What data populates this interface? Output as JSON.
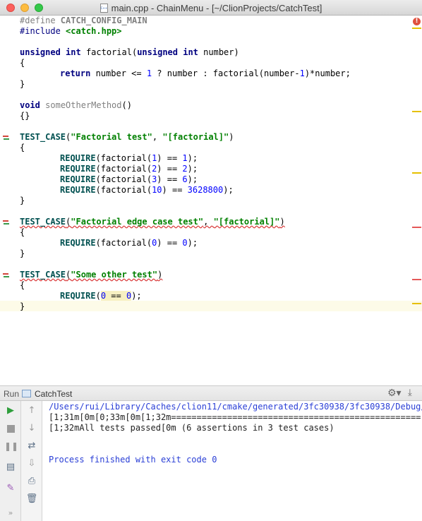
{
  "window": {
    "title": "main.cpp - ChainMenu - [~/ClionProjects/CatchTest]"
  },
  "editor": {
    "lines": {
      "l1_define": "#define",
      "l1_name": " CATCH_CONFIG_MAIN",
      "l2_include": "#include",
      "l2_header": "<catch.hpp>",
      "l4_unsigned1": "unsigned",
      "l4_int1": "int",
      "l4_name": " factorial(",
      "l4_unsigned2": "unsigned",
      "l4_int2": "int",
      "l4_param": " number)",
      "l5": "{",
      "l6_return": "return",
      "l6_a": " number <= ",
      "l6_n1": "1",
      "l6_b": " ? number : factorial(number-",
      "l6_n2": "1",
      "l6_c": ")*number;",
      "l7": "}",
      "l9_void": "void",
      "l9_name": "someOtherMethod",
      "l9_paren": "()",
      "l10": "{}",
      "l12_macro": "TEST_CASE",
      "l12_open": "(",
      "l12_s1": "\"Factorial test\"",
      "l12_sep": ", ",
      "l12_s2": "\"[factorial]\"",
      "l12_close": ")",
      "l13": "{",
      "req": "REQUIRE",
      "l14_a": "(factorial(",
      "l14_n1": "1",
      "l14_b": ") == ",
      "l14_n2": "1",
      "l14_c": ");",
      "l15_n1": "2",
      "l15_n2": "2",
      "l16_n1": "3",
      "l16_n2": "6",
      "l17_n1": "10",
      "l17_n2": "3628800",
      "l18": "}",
      "l20_macro": "TEST_CASE",
      "l20_open": "(",
      "l20_s1": "\"Factorial edge case test\"",
      "l20_sep": ", ",
      "l20_s2": "\"[factorial]\"",
      "l20_close": ")",
      "l21": "{",
      "l22_n1": "0",
      "l22_n2": "0",
      "l23": "}",
      "l25_macro": "TEST_CASE",
      "l25_open": "(",
      "l25_s1": "\"Some other test\"",
      "l25_close": ")",
      "l26": "{",
      "l27_open": "(",
      "l27_n1": "0",
      "l27_eq": " == ",
      "l27_n2": "0",
      "l27_close": ");",
      "l28": "}"
    },
    "error_badge": "!"
  },
  "run_panel": {
    "label": "Run",
    "tab": "CatchTest",
    "console": {
      "line1": "/Users/rui/Library/Caches/clion11/cmake/generated/3fc30938/3fc30938/Debug/Ca",
      "line2": "[1;31m[0m[0;33m[0m[1;32m=================================================",
      "line3": "[1;32mAll tests passed[0m (6 assertions in 3 test cases)",
      "line4": "Process finished with exit code 0"
    },
    "icons": {
      "gear": "gear-icon",
      "hide": "hide-icon",
      "run": "play-icon",
      "stop": "stop-icon",
      "pause": "pause-icon"
    },
    "more": "»"
  },
  "colors": {
    "keyword": "#000080",
    "string": "#008000",
    "number": "#0000ff",
    "console_link": "#2a3fd6",
    "error": "#e55858",
    "warning": "#e6c000"
  }
}
